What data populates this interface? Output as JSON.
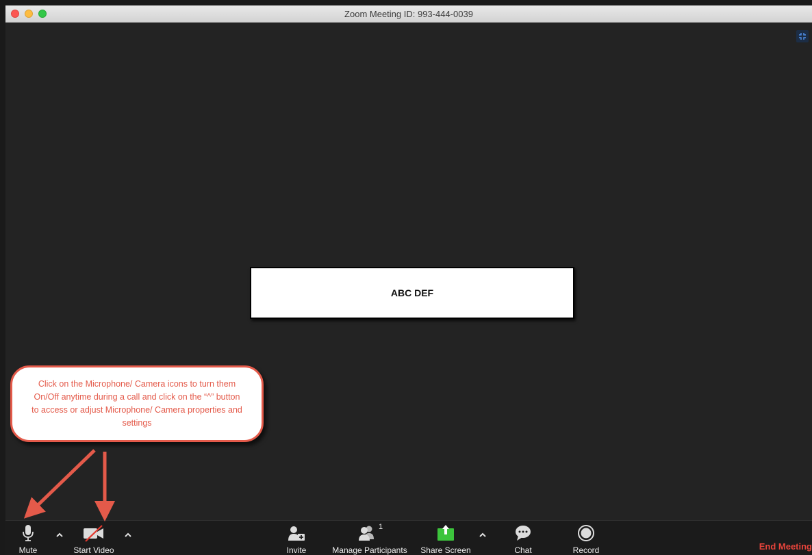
{
  "window": {
    "title": "Zoom Meeting ID: 993-444-0039",
    "traffic_lights": [
      "#fc5753",
      "#fdbc40",
      "#33c748"
    ]
  },
  "video": {
    "participant_name": "ABC DEF",
    "fullscreen_icon": "exit-fullscreen-icon"
  },
  "toolbar": {
    "mute": {
      "label": "Mute",
      "icon": "microphone-icon"
    },
    "start_video": {
      "label": "Start Video",
      "icon": "video-off-icon"
    },
    "invite": {
      "label": "Invite",
      "icon": "invite-icon"
    },
    "participants": {
      "label": "Manage Participants",
      "count": "1",
      "icon": "participants-icon"
    },
    "share_screen": {
      "label": "Share Screen",
      "icon": "share-screen-icon",
      "color": "#3cc43c"
    },
    "chat": {
      "label": "Chat",
      "icon": "chat-icon"
    },
    "record": {
      "label": "Record",
      "icon": "record-icon"
    },
    "end_meeting": {
      "label": "End Meeting",
      "color": "#e7443b"
    }
  },
  "annotation": {
    "callout_text": "Click on the Microphone/ Camera icons to turn them On/Off anytime during a call and click on the “^” button to access or adjust Microphone/ Camera properties and settings",
    "color": "#e45a4a"
  }
}
